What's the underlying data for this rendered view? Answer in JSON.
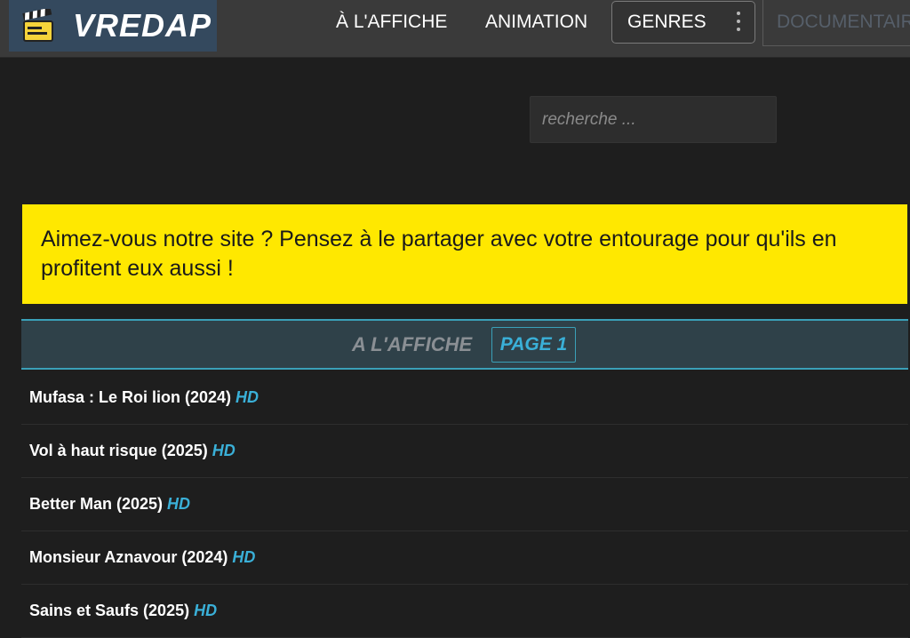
{
  "header": {
    "logo_text": "VREDAP",
    "logo_icon": "clapperboard-icon",
    "nav": {
      "affiche": "À L'AFFICHE",
      "animation": "ANIMATION",
      "genres": "GENRES",
      "documentaire": "DOCUMENTAIRE"
    }
  },
  "search": {
    "placeholder": "recherche ..."
  },
  "banner": {
    "text": "Aimez-vous notre site ? Pensez à le partager avec votre entourage pour qu'ils en profitent eux aussi !"
  },
  "section": {
    "title": "A L'AFFICHE",
    "page_label": "PAGE 1"
  },
  "movies": [
    {
      "title": "Mufasa : Le Roi lion (2024)",
      "quality": "HD"
    },
    {
      "title": "Vol à haut risque (2025)",
      "quality": "HD"
    },
    {
      "title": "Better Man (2025)",
      "quality": "HD"
    },
    {
      "title": "Monsieur Aznavour (2024)",
      "quality": "HD"
    },
    {
      "title": "Sains et Saufs (2025)",
      "quality": "HD"
    }
  ],
  "colors": {
    "banner_bg": "#ffe800",
    "accent": "#3ab0d8",
    "logo_bg": "#34495e",
    "page_bg": "#1e1e1e"
  }
}
